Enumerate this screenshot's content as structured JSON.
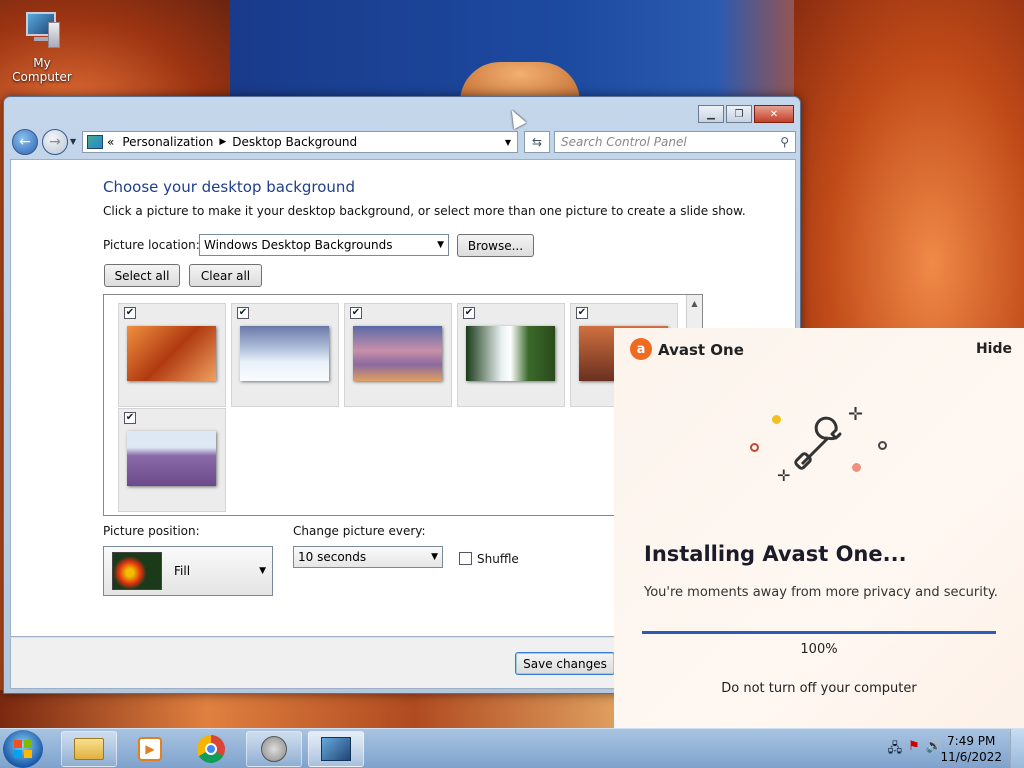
{
  "desktop": {
    "icon_label": "My Computer"
  },
  "window": {
    "breadcrumb": [
      "Personalization",
      "Desktop Background"
    ],
    "breadcrumb_prefix": "«",
    "search_placeholder": "Search Control Panel",
    "heading": "Choose your desktop background",
    "description": "Click a picture to make it your desktop background, or select more than one picture to create a slide show.",
    "picture_location_label": "Picture location:",
    "picture_location_value": "Windows Desktop Backgrounds",
    "browse_label": "Browse...",
    "select_all_label": "Select all",
    "clear_all_label": "Clear all",
    "pictures": [
      {
        "name": "canyon",
        "checked": true
      },
      {
        "name": "glacier",
        "checked": true
      },
      {
        "name": "coast-sunset",
        "checked": true
      },
      {
        "name": "waterfall",
        "checked": true
      },
      {
        "name": "arch",
        "checked": true
      },
      {
        "name": "lavender-field",
        "checked": true
      }
    ],
    "picture_position_label": "Picture position:",
    "picture_position_value": "Fill",
    "change_every_label": "Change picture every:",
    "change_every_value": "10 seconds",
    "shuffle_label": "Shuffle",
    "shuffle_checked": false,
    "save_label": "Save changes"
  },
  "avast": {
    "brand": "Avast One",
    "hide_label": "Hide",
    "title": "Installing Avast One...",
    "subtitle": "You're moments away from more privacy and security.",
    "progress": 1.0,
    "progress_text": "100%",
    "warning": "Do not turn off your computer",
    "accent": "#f06a20",
    "progress_color": "#2a5db8"
  },
  "taskbar": {
    "time": "7:49 PM",
    "date": "11/6/2022"
  }
}
